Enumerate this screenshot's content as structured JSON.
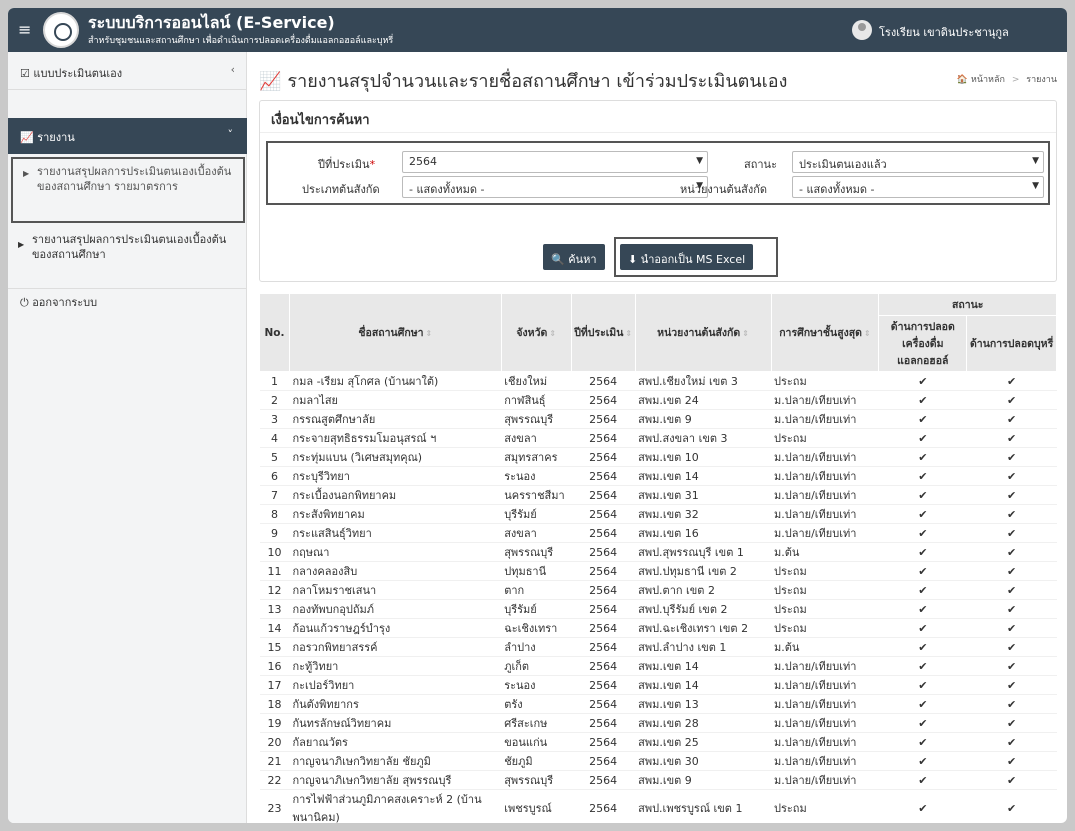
{
  "header": {
    "title": "ระบบบริการออนไลน์ (E-Service)",
    "subtitle": "สำหรับชุมชนและสถานศึกษา เพื่อดำเนินการปลอดเครื่องดื่มแอลกอฮอล์และบุหรี่",
    "user": "โรงเรียน เขาดินประชานุกูล"
  },
  "sidebar": {
    "assess": "แบบประเมินตนเอง",
    "report": "รายงาน",
    "sub1": "รายงานสรุปผลการประเมินตนเองเบื้องต้นของสถานศึกษา รายมาตรการ",
    "sub2": "รายงานสรุปผลการประเมินตนเองเบื้องต้นของสถานศึกษา",
    "logout": "ออกจากระบบ"
  },
  "page": {
    "title": "รายงานสรุปจำนวนและรายชื่อสถานศึกษา เข้าร่วมประเมินตนเอง",
    "breadcrumb_home": "หน้าหลัก",
    "breadcrumb_sep": ">",
    "breadcrumb_current": "รายงาน"
  },
  "search": {
    "heading": "เงื่อนไขการค้นหา",
    "year_label": "ปีที่ประเมิน",
    "year_required": "*",
    "year_value": "2564",
    "status_label": "สถานะ",
    "status_value": "ประเมินตนเองแล้ว",
    "type_label": "ประเภทต้นสังกัด",
    "type_value": "- แสดงทั้งหมด -",
    "agency_label": "หน่วยงานต้นสังกัด",
    "agency_value": "- แสดงทั้งหมด -",
    "search_btn": "ค้นหา",
    "export_btn": "นำออกเป็น MS Excel"
  },
  "table": {
    "headers": {
      "no": "No.",
      "name": "ชื่อสถานศึกษา",
      "province": "จังหวัด",
      "year": "ปีที่ประเมิน",
      "agency": "หน่วยงานต้นสังกัด",
      "level": "การศึกษาชั้นสูงสุด",
      "status": "สถานะ",
      "alcohol": "ด้านการปลอดเครื่องดื่มแอลกอฮอล์",
      "tobacco": "ด้านการปลอดบุหรี่"
    },
    "check": "✔",
    "rows": [
      [
        "1",
        "กมล -เรียม สุโกศล (บ้านผาใต้)",
        "เชียงใหม่",
        "2564",
        "สพป.เชียงใหม่ เขต 3",
        "ประถม"
      ],
      [
        "2",
        "กมลาไสย",
        "กาฬสินธุ์",
        "2564",
        "สพม.เขต 24",
        "ม.ปลาย/เทียบเท่า"
      ],
      [
        "3",
        "กรรณสูตศึกษาลัย",
        "สุพรรณบุรี",
        "2564",
        "สพม.เขต 9",
        "ม.ปลาย/เทียบเท่า"
      ],
      [
        "4",
        "กระจายสุทธิธรรมโมอนุสรณ์ ฯ",
        "สงขลา",
        "2564",
        "สพป.สงขลา เขต 3",
        "ประถม"
      ],
      [
        "5",
        "กระทุ่มแบน (วิเศษสมุทคุณ)",
        "สมุทรสาคร",
        "2564",
        "สพม.เขต 10",
        "ม.ปลาย/เทียบเท่า"
      ],
      [
        "6",
        "กระบุรีวิทยา",
        "ระนอง",
        "2564",
        "สพม.เขต 14",
        "ม.ปลาย/เทียบเท่า"
      ],
      [
        "7",
        "กระเบื้องนอกพิทยาคม",
        "นครราชสีมา",
        "2564",
        "สพม.เขต 31",
        "ม.ปลาย/เทียบเท่า"
      ],
      [
        "8",
        "กระสังพิทยาคม",
        "บุรีรัมย์",
        "2564",
        "สพม.เขต 32",
        "ม.ปลาย/เทียบเท่า"
      ],
      [
        "9",
        "กระแสสินธุ์วิทยา",
        "สงขลา",
        "2564",
        "สพม.เขต 16",
        "ม.ปลาย/เทียบเท่า"
      ],
      [
        "10",
        "กฤษณา",
        "สุพรรณบุรี",
        "2564",
        "สพป.สุพรรณบุรี เขต 1",
        "ม.ต้น"
      ],
      [
        "11",
        "กลางคลองสิบ",
        "ปทุมธานี",
        "2564",
        "สพป.ปทุมธานี เขต 2",
        "ประถม"
      ],
      [
        "12",
        "กลาโหมราชเสนา",
        "ตาก",
        "2564",
        "สพป.ตาก เขต 2",
        "ประถม"
      ],
      [
        "13",
        "กองทัพบกอุปถัมภ์",
        "บุรีรัมย์",
        "2564",
        "สพป.บุรีรัมย์ เขต 2",
        "ประถม"
      ],
      [
        "14",
        "ก้อนแก้วราษฎร์บำรุง",
        "ฉะเชิงเทรา",
        "2564",
        "สพป.ฉะเชิงเทรา เขต 2",
        "ประถม"
      ],
      [
        "15",
        "กอรวกพิทยาสรรค์",
        "ลำปาง",
        "2564",
        "สพป.ลำปาง เขต 1",
        "ม.ต้น"
      ],
      [
        "16",
        "กะทู้วิทยา",
        "ภูเก็ต",
        "2564",
        "สพม.เขต 14",
        "ม.ปลาย/เทียบเท่า"
      ],
      [
        "17",
        "กะเปอร์วิทยา",
        "ระนอง",
        "2564",
        "สพม.เขต 14",
        "ม.ปลาย/เทียบเท่า"
      ],
      [
        "18",
        "กันตังพิทยากร",
        "ตรัง",
        "2564",
        "สพม.เขต 13",
        "ม.ปลาย/เทียบเท่า"
      ],
      [
        "19",
        "กันทรลักษณ์วิทยาคม",
        "ศรีสะเกษ",
        "2564",
        "สพม.เขต 28",
        "ม.ปลาย/เทียบเท่า"
      ],
      [
        "20",
        "กัลยาณวัตร",
        "ขอนแก่น",
        "2564",
        "สพม.เขต 25",
        "ม.ปลาย/เทียบเท่า"
      ],
      [
        "21",
        "กาญจนาภิเษกวิทยาลัย ชัยภูมิ",
        "ชัยภูมิ",
        "2564",
        "สพม.เขต 30",
        "ม.ปลาย/เทียบเท่า"
      ],
      [
        "22",
        "กาญจนาภิเษกวิทยาลัย สุพรรณบุรี",
        "สุพรรณบุรี",
        "2564",
        "สพม.เขต 9",
        "ม.ปลาย/เทียบเท่า"
      ],
      [
        "23",
        "การไฟฟ้าส่วนภูมิภาคสงเคราะห์ 2 (บ้านพนานิคม)",
        "เพชรบูรณ์",
        "2564",
        "สพป.เพชรบูรณ์ เขต 1",
        "ประถม"
      ]
    ]
  }
}
